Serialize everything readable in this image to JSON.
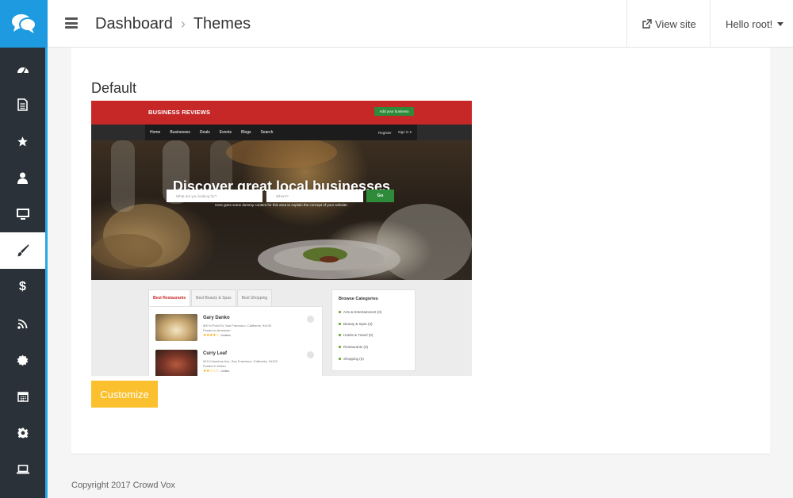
{
  "sidebar": {
    "logo": "chat-bubbles-icon",
    "items": [
      {
        "icon": "dashboard-icon",
        "active": false
      },
      {
        "icon": "document-icon",
        "active": false
      },
      {
        "icon": "star-icon",
        "active": false
      },
      {
        "icon": "user-icon",
        "active": false
      },
      {
        "icon": "monitor-icon",
        "active": false
      },
      {
        "icon": "paintbrush-icon",
        "active": true
      },
      {
        "icon": "dollar-icon",
        "active": false
      },
      {
        "icon": "rss-icon",
        "active": false
      },
      {
        "icon": "badge-icon",
        "active": false
      },
      {
        "icon": "calendar-icon",
        "active": false
      },
      {
        "icon": "gear-icon",
        "active": false
      },
      {
        "icon": "laptop-icon",
        "active": false
      }
    ],
    "accent_color": "#26a8e8",
    "bg_color": "#2a3138"
  },
  "header": {
    "breadcrumb": [
      "Dashboard",
      "Themes"
    ],
    "view_site": "View site",
    "user_menu": "Hello root!"
  },
  "theme": {
    "name": "Default",
    "customize_label": "Customize",
    "button_color": "#fbc02d"
  },
  "preview": {
    "brand": "BUSINESS REVIEWS",
    "add_business": "Add your business",
    "nav": [
      "Home",
      "Businesses",
      "Deals",
      "Events",
      "Blogs",
      "Search"
    ],
    "nav_right": [
      "Register",
      "Sign in ▾"
    ],
    "hero_title": "Discover great local businesses",
    "hero_sub": "Here goes some dummy content for this area to explain the concept of your website.",
    "search_placeholder": "What are you looking for?",
    "where_placeholder": "Where?",
    "go": "Go",
    "tabs": [
      "Best Restaurants",
      "Best Beauty & Spas",
      "Best Shopping"
    ],
    "listings": [
      {
        "name": "Gary Danko",
        "address": "800 N Point St, San Francisco, California, 94109",
        "category": "Posted in American",
        "stars": "★★★★☆",
        "reviews": "2 reviews"
      },
      {
        "name": "Curry Leaf",
        "address": "943 Columbus Ave, San Francisco, California, 94133",
        "category": "Posted in Indian",
        "stars": "★★☆☆☆",
        "reviews": "1 review"
      }
    ],
    "categories_title": "Browse Categories",
    "categories": [
      "Arts & Entertainment (0)",
      "Beauty & Spas (3)",
      "Hotels & Travel (0)",
      "Restaurants (3)",
      "Shopping (3)"
    ]
  },
  "footer": {
    "copyright": "Copyright 2017 Crowd Vox"
  }
}
